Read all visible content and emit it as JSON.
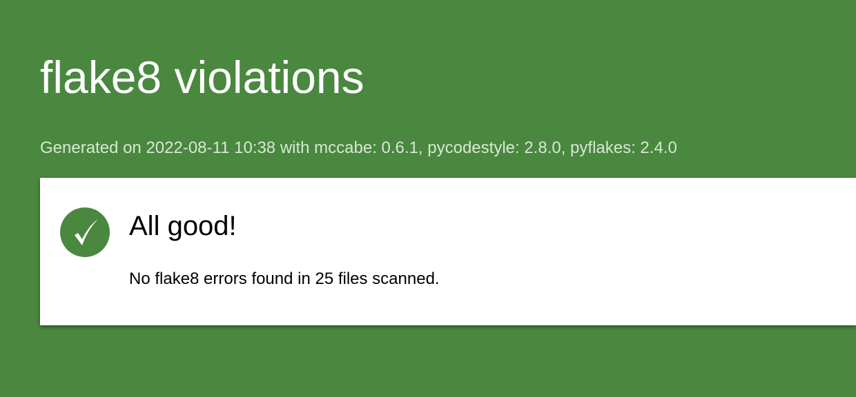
{
  "header": {
    "title": "flake8 violations",
    "generated": "Generated on 2022-08-11 10:38 with mccabe: 0.6.1, pycodestyle: 2.8.0, pyflakes: 2.4.0"
  },
  "result": {
    "icon": "checkmark-icon",
    "heading": "All good!",
    "message": "No flake8 errors found in 25 files scanned."
  },
  "colors": {
    "background": "#4a873f",
    "card": "#ffffff",
    "subtitle": "#d8e8d3"
  }
}
